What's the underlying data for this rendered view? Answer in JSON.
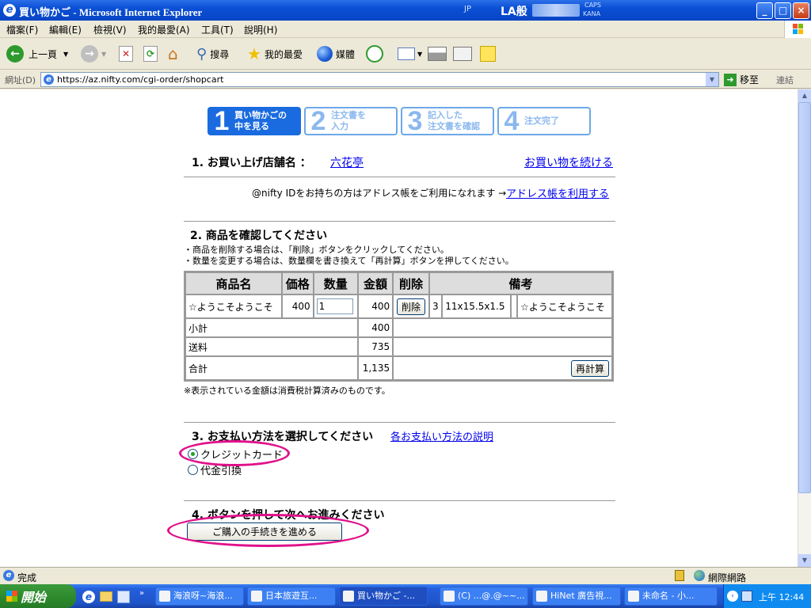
{
  "window": {
    "title": "買い物かご - Microsoft Internet Explorer",
    "lang_indicator": "JP",
    "ime_text": "LA般",
    "caps_text": "CAPS",
    "kana_text": "KANA"
  },
  "menu": [
    "檔案(F)",
    "編輯(E)",
    "檢視(V)",
    "我的最愛(A)",
    "工具(T)",
    "說明(H)"
  ],
  "toolbar": {
    "back": "上一頁",
    "search": "搜尋",
    "favorites": "我的最愛",
    "media": "媒體"
  },
  "address": {
    "label": "網址(D)",
    "url": "https://az.nifty.com/cgi-order/shopcart",
    "go": "移至",
    "links": "連結"
  },
  "steps": [
    {
      "num": "1",
      "line1": "買い物かごの",
      "line2": "中を見る"
    },
    {
      "num": "2",
      "line1": "注文書を",
      "line2": "入力"
    },
    {
      "num": "3",
      "line1": "記入した",
      "line2": "注文書を確認"
    },
    {
      "num": "4",
      "line1": "注文完了",
      "line2": ""
    }
  ],
  "section1": {
    "heading": "1. お買い上げ店舗名 ：",
    "shop_name": "六花亭",
    "continue_link": "お買い物を続ける",
    "nifty_text": "@nifty IDをお持ちの方はアドレス帳をご利用になれます →",
    "address_link": "アドレス帳を利用する"
  },
  "section2": {
    "heading": "2. 商品を確認してください",
    "note1": "・商品を削除する場合は、「削除」ボタンをクリックしてください。",
    "note2": "・数量を変更する場合は、数量欄を書き換えて「再計算」ボタンを押してください。",
    "headers": [
      "商品名",
      "価格",
      "数量",
      "金額",
      "削除",
      "備考"
    ],
    "item": {
      "name": "☆ようこそようこそ",
      "price": "400",
      "qty": "1",
      "amount": "400",
      "delete": "削除",
      "col_a": "3",
      "col_b": "11x15.5x1.5",
      "col_c": "☆ようこそようこそ"
    },
    "subtotal_label": "小計",
    "subtotal": "400",
    "shipping_label": "送料",
    "shipping": "735",
    "total_label": "合計",
    "total": "1,135",
    "recalc": "再計算",
    "tax_note": "※表示されている金額は消費税計算済みのものです。"
  },
  "section3": {
    "heading": "3. お支払い方法を選択してください",
    "help_link": "各お支払い方法の説明",
    "options": [
      "クレジットカード",
      "代金引換"
    ]
  },
  "section4": {
    "heading": "4. ボタンを押して次へお進みください",
    "proceed": "ご購入の手続きを進める"
  },
  "status": {
    "text": "完成",
    "zone": "網際網路"
  },
  "taskbar": {
    "start": "開始",
    "tasks": [
      "海浪呀~海浪...",
      "日本旅遊互...",
      "買い物かご -...",
      "(C) ...@.@~~...",
      "HiNet 廣告視...",
      "未命名 - 小..."
    ],
    "clock": "上午 12:44"
  }
}
